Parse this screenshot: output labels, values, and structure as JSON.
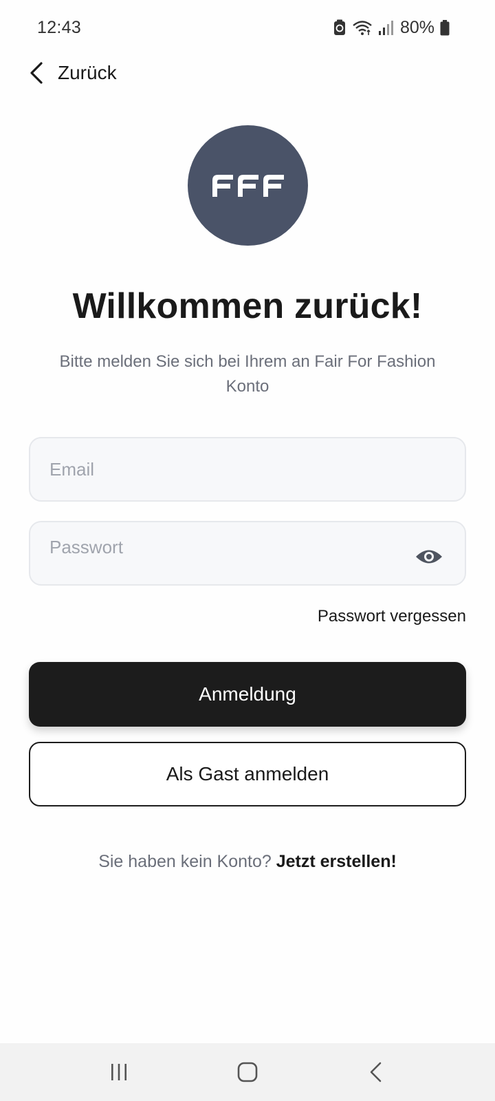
{
  "status_bar": {
    "time": "12:43",
    "battery": "80%",
    "icons": [
      "data-saver-icon",
      "wifi-icon",
      "signal-icon",
      "battery-icon"
    ]
  },
  "nav": {
    "back_label": "Zurück",
    "back_icon": "chevron-left-icon"
  },
  "logo": {
    "text": "FFF",
    "background": "#4a5368"
  },
  "title": "Willkommen zurück!",
  "subtitle": "Bitte melden Sie sich bei Ihrem an Fair For Fashion Konto",
  "form": {
    "email_placeholder": "Email",
    "email_value": "",
    "password_placeholder": "Passwort",
    "password_value": "",
    "password_toggle_icon": "eye-icon",
    "forgot_label": "Passwort vergessen"
  },
  "buttons": {
    "login_label": "Anmeldung",
    "guest_label": "Als Gast anmelden"
  },
  "signup": {
    "prefix": "Sie haben kein Konto?",
    "link": "Jetzt erstellen!"
  },
  "colors": {
    "primary": "#1c1c1c",
    "logo_bg": "#4a5368",
    "muted_text": "#6b6f7a",
    "field_bg": "#f7f8fa"
  },
  "system_nav": {
    "icons": [
      "recent-apps-icon",
      "home-icon",
      "back-icon"
    ]
  }
}
